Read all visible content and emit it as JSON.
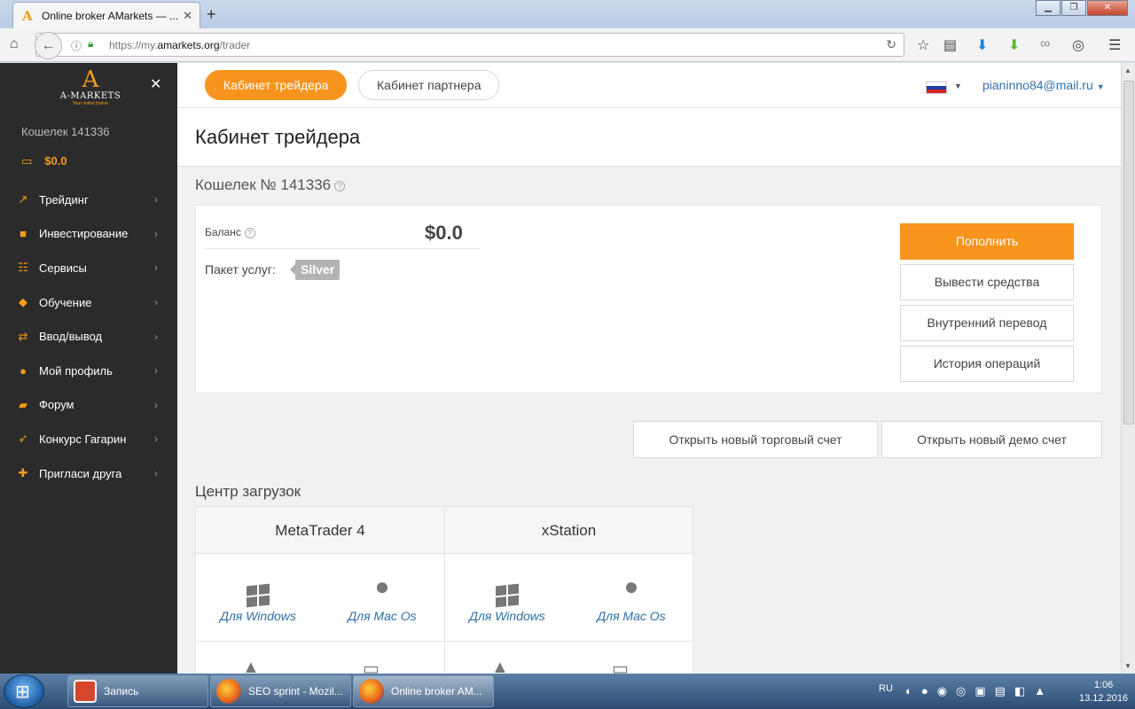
{
  "browser": {
    "tab_title": "Online broker AMarkets — ...",
    "tab_close": "✕",
    "new_tab": "+",
    "url_prefix": "https://my.",
    "url_domain": "amarkets.org",
    "url_path": "/trader"
  },
  "sidebar": {
    "logo_text": "A-MARKETS",
    "logo_tagline": "Your online broker",
    "wallet_label": "Кошелек 141336",
    "wallet_amount": "$0.0",
    "items": [
      {
        "label": "Трейдинг",
        "icon": "trending-up-icon"
      },
      {
        "label": "Инвестирование",
        "icon": "briefcase-icon"
      },
      {
        "label": "Сервисы",
        "icon": "sliders-icon"
      },
      {
        "label": "Обучение",
        "icon": "graduation-cap-icon"
      },
      {
        "label": "Ввод/вывод",
        "icon": "exchange-icon"
      },
      {
        "label": "Мой профиль",
        "icon": "user-icon"
      },
      {
        "label": "Форум",
        "icon": "comments-icon"
      },
      {
        "label": "Конкурс Гагарин",
        "icon": "rocket-icon"
      },
      {
        "label": "Пригласи друга",
        "icon": "gift-icon"
      }
    ]
  },
  "topbar": {
    "tab_trader": "Кабинет трейдера",
    "tab_partner": "Кабинет партнера",
    "email": "pianinno84@mail.ru"
  },
  "page": {
    "title": "Кабинет трейдера",
    "wallet_title": "Кошелек № 141336",
    "balance_label": "Баланс",
    "balance_value": "$0.0",
    "package_label": "Пакет услуг:",
    "package_value": "Silver",
    "actions": {
      "deposit": "Пополнить",
      "withdraw": "Вывести средства",
      "transfer": "Внутренний перевод",
      "history": "История операций"
    },
    "open_real": "Открыть новый торговый счет",
    "open_demo": "Открыть новый демо счет",
    "downloads_title": "Центр загрузок",
    "downloads": [
      {
        "platform": "MetaTrader 4",
        "windows": "Для Windows",
        "mac": "Для Mac Os"
      },
      {
        "platform": "xStation",
        "windows": "Для Windows",
        "mac": "Для Mac Os"
      }
    ]
  },
  "taskbar": {
    "items": [
      "Запись",
      "SEO sprint - Mozil...",
      "Online broker AM..."
    ],
    "lang": "RU",
    "time": "1:06",
    "date": "13.12.2016"
  },
  "colors": {
    "accent": "#f7941d",
    "sidebar_bg": "#2b2b2b",
    "link": "#2f72b3"
  }
}
